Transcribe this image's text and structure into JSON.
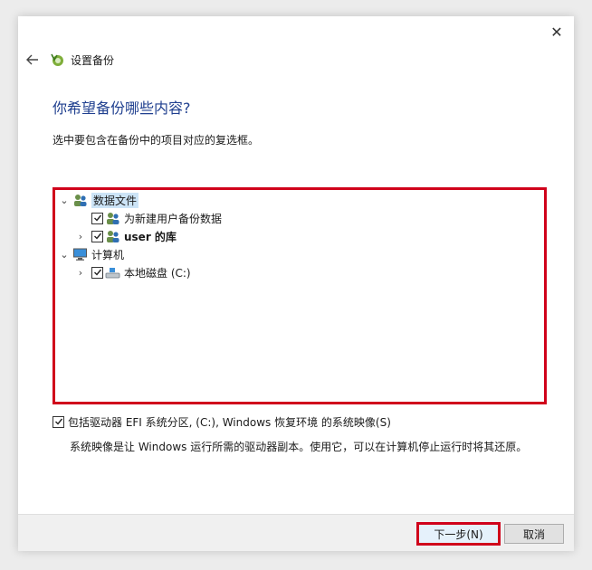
{
  "window": {
    "close_glyph": "✕"
  },
  "header": {
    "title": "设置备份",
    "back_icon": "back-arrow-icon",
    "app_icon": "backup-icon"
  },
  "main": {
    "heading": "你希望备份哪些内容?",
    "instruction": "选中要包含在备份中的项目对应的复选框。"
  },
  "tree": {
    "items": [
      {
        "label": "数据文件",
        "expanded": true,
        "selected": true,
        "icon": "users-icon"
      },
      {
        "label": "为新建用户备份数据",
        "checked": true,
        "icon": "users-icon"
      },
      {
        "label": "user 的库",
        "checked": true,
        "icon": "users-icon",
        "expanded": false
      },
      {
        "label": "计算机",
        "expanded": true,
        "icon": "computer-icon"
      },
      {
        "label": "本地磁盘 (C:)",
        "checked": true,
        "icon": "drive-icon",
        "expanded": false
      }
    ]
  },
  "system_image": {
    "checkbox_label": "包括驱动器 EFI 系统分区, (C:), Windows 恢复环境 的系统映像(S)",
    "checked": true,
    "note": "系统映像是让 Windows 运行所需的驱动器副本。使用它，可以在计算机停止运行时将其还原。"
  },
  "footer": {
    "next_label": "下一步(N)",
    "cancel_label": "取消"
  },
  "colors": {
    "highlight_border": "#d0021b",
    "heading": "#1f3f8f",
    "selection": "#cce4f7"
  }
}
